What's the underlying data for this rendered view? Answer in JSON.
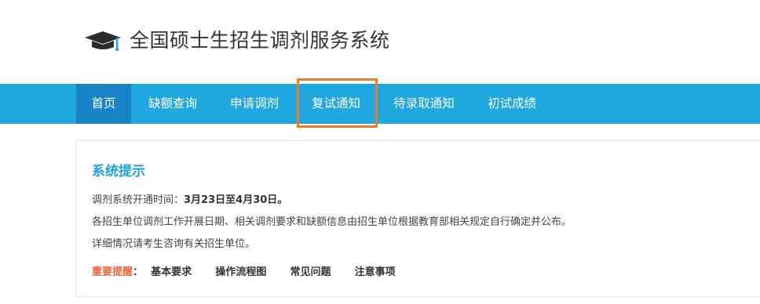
{
  "header": {
    "title": "全国硕士生招生调剂服务系统",
    "logo_icon": "graduation-cap-icon"
  },
  "nav": {
    "items": [
      {
        "label": "首页",
        "active": true
      },
      {
        "label": "缺额查询"
      },
      {
        "label": "申请调剂"
      },
      {
        "label": "复试通知",
        "highlighted": true
      },
      {
        "label": "待录取通知"
      },
      {
        "label": "初试成绩"
      }
    ]
  },
  "notice": {
    "title": "系统提示",
    "open_time_label": "调剂系统开通时间：",
    "open_time_value": "3月23日至4月30日。",
    "line2": "各招生单位调剂工作开展日期、相关调剂要求和缺额信息由招生单位根据教育部相关规定自行确定并公布。",
    "line3": "详细情况请考生咨询有关招生单位。",
    "reminder_label": "重要提醒",
    "reminder_colon": "：",
    "links": [
      "基本要求",
      "操作流程图",
      "常见问题",
      "注意事项"
    ]
  },
  "colors": {
    "nav_bg": "#1fa7e0",
    "nav_active": "#1884c7",
    "highlight_border": "#f07a2b",
    "title_blue": "#1fa0d8",
    "reminder_red": "#e8643a"
  }
}
